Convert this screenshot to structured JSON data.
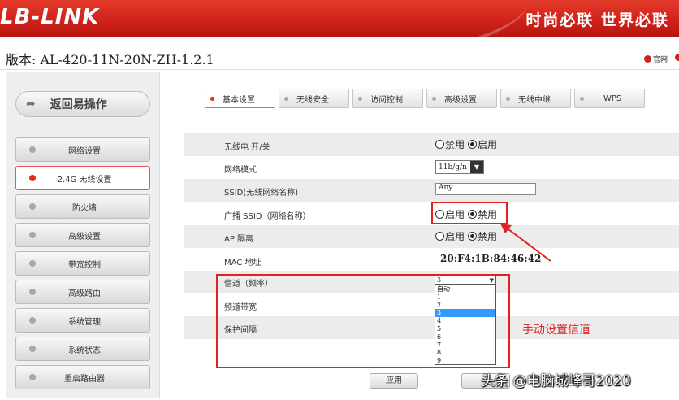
{
  "header": {
    "logo": "LB-LINK",
    "slogan": "时尚必联  世界必联"
  },
  "version_bar": {
    "version": "版本: AL-420-11N-20N-ZH-1.2.1",
    "official_link": "官网"
  },
  "sidebar": {
    "back_label": "返回易操作",
    "items": [
      {
        "label": "网络设置"
      },
      {
        "label": "2.4G 无线设置"
      },
      {
        "label": "防火墙"
      },
      {
        "label": "高级设置"
      },
      {
        "label": "带宽控制"
      },
      {
        "label": "高级路由"
      },
      {
        "label": "系统管理"
      },
      {
        "label": "系统状态"
      },
      {
        "label": "重启路由器"
      }
    ]
  },
  "tabs": [
    {
      "label": "基本设置"
    },
    {
      "label": "无线安全"
    },
    {
      "label": "访问控制"
    },
    {
      "label": "高级设置"
    },
    {
      "label": "无线中继"
    },
    {
      "label": "WPS"
    }
  ],
  "form": {
    "radio_switch": {
      "label": "无线电 开/关",
      "opt1": "禁用",
      "opt2": "启用",
      "selected": "启用"
    },
    "network_mode": {
      "label": "网络模式",
      "value": "11b/g/n"
    },
    "ssid": {
      "label": "SSID(无线网络名称)",
      "value": "Any"
    },
    "broadcast_ssid": {
      "label": "广播 SSID（网络名称）",
      "opt1": "启用",
      "opt2": "禁用",
      "selected": "禁用"
    },
    "ap_isolation": {
      "label": "AP 隔离",
      "opt1": "启用",
      "opt2": "禁用",
      "selected": "禁用"
    },
    "mac": {
      "label": "MAC 地址",
      "value": "20:F4:1B:84:46:42"
    },
    "channel": {
      "label": "信道（频率）",
      "value": "3",
      "options": [
        "自动",
        "1",
        "2",
        "3",
        "4",
        "5",
        "6",
        "7",
        "8",
        "9"
      ]
    },
    "bandwidth": {
      "label": "频道带宽"
    },
    "guard_interval": {
      "label": "保护间隔"
    }
  },
  "buttons": {
    "apply": "应用"
  },
  "annotation": {
    "text": "手动设置信道"
  },
  "watermark": "头条 @电脑城峰哥2020",
  "colors": {
    "brand_red": "#d0221b",
    "annotation_red": "#e02222",
    "selected_option": "#3399ff"
  }
}
